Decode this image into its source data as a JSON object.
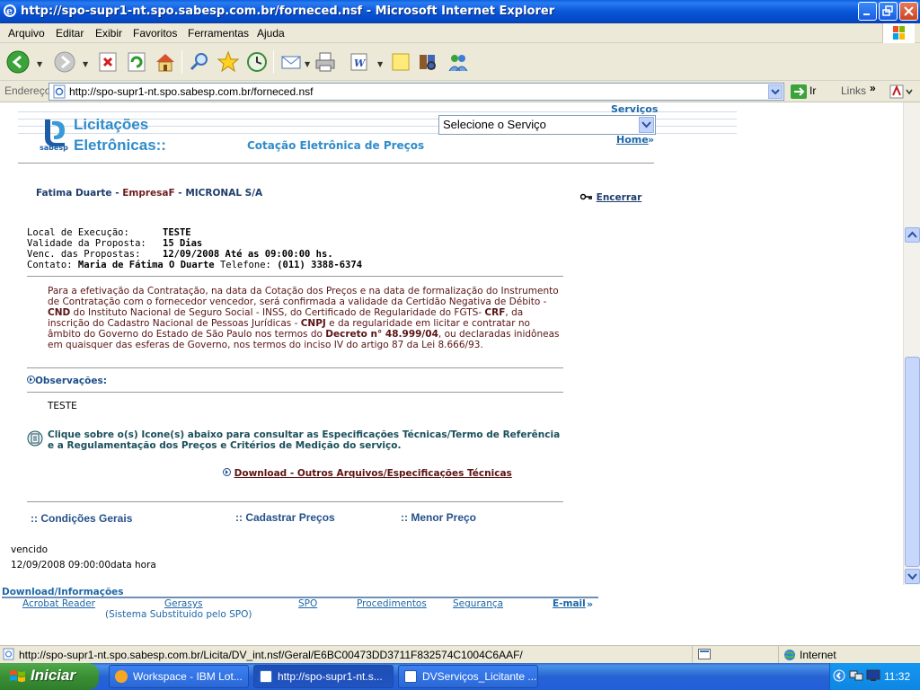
{
  "window": {
    "title": "http://spo-supr1-nt.spo.sabesp.com.br/forneced.nsf - Microsoft Internet Explorer"
  },
  "menubar": {
    "items": [
      "Arquivo",
      "Editar",
      "Exibir",
      "Favoritos",
      "Ferramentas",
      "Ajuda"
    ]
  },
  "addressbar": {
    "label": "Endereço",
    "url": "http://spo-supr1-nt.spo.sabesp.com.br/forneced.nsf",
    "go": "Ir",
    "links": "Links"
  },
  "header": {
    "logo_line1": "Licitações",
    "logo_line2": "Eletrônicas::",
    "logo_brand": "sabesp",
    "subtitle": "Cotação Eletrônica de Preços",
    "servicos_label": "Serviços",
    "service_select": "Selecione o Serviço",
    "home_link": "Home",
    "home_arrow": "»"
  },
  "user": {
    "name": "Fatima Duarte",
    "sep1": " - ",
    "company_label": "EmpresaF",
    "sep2": " - ",
    "company": "MICRONAL S/A",
    "logout": "Encerrar"
  },
  "details": {
    "local_label": "Local de Execução:",
    "local_value": "TESTE",
    "validade_label": "Validade da Proposta:",
    "validade_value": "15 Dias",
    "venc_label": "Venc. das Propostas:",
    "venc_value": "12/09/2008 Até as 09:00:00 hs.",
    "contato_label": "Contato:",
    "contato_value": "Maria de Fátima O Duarte",
    "telefone_label": "Telefone:",
    "telefone_value": "(011) 3388-6374"
  },
  "notice": {
    "p1": "Para a efetivação da Contratação, na data da Cotação dos Preços e na data de formalização do Instrumento de Contratação com o fornecedor vencedor, será confirmada a validade da Certidão Negativa de Débito - ",
    "cnd": "CND",
    "p2": " do Instituto Nacional de Seguro Social - INSS, do Certificado de Regularidade do FGTS- ",
    "crf": "CRF",
    "p3": ", da inscrição do Cadastro Nacional de Pessoas Jurídicas - ",
    "cnpj": "CNPJ",
    "p4": " e da regularidade em licitar e contratar no âmbito do Governo do Estado de São Paulo nos termos do ",
    "decreto": "Decreto n° 48.999/04",
    "p5": ", ou declaradas inidôneas em quaisquer das esferas de Governo, nos termos do inciso IV do artigo 87 da Lei 8.666/93."
  },
  "observacoes": {
    "label": "Observações:",
    "value": "TESTE"
  },
  "specs": {
    "text": "Clique sobre o(s) Icone(s) abaixo para consultar as Especificações Técnicas/Termo de Referência e a Regulamentação dos Preços e Critérios de Medição do serviço.",
    "download_link": "Download - Outros Arquivos/Especificações Técnicas"
  },
  "tabs": {
    "condicoes": ":: Condições Gerais",
    "cadastrar": ":: Cadastrar Preços",
    "menor": ":: Menor Preço"
  },
  "status_text": {
    "line1": "vencido",
    "line2": "12/09/2008 09:00:00data hora"
  },
  "footer": {
    "title": "Download/Informações",
    "links": [
      "Acrobat Reader",
      "Gerasys",
      "SPO",
      "Procedimentos",
      "Segurança",
      "E-mail"
    ],
    "email_arrow": "»",
    "note": "(Sistema Substituido pelo SPO)"
  },
  "statusbar": {
    "url": "http://spo-supr1-nt.spo.sabesp.com.br/Licita/DV_int.nsf/Geral/E6BC00473DD3711F832574C1004C6AAF/",
    "zone": "Internet"
  },
  "taskbar": {
    "start": "Iniciar",
    "tasks": [
      "Workspace - IBM Lot...",
      "http://spo-supr1-nt.s...",
      "DVServiços_Licitante ..."
    ],
    "clock": "11:32"
  },
  "colors": {
    "link_blue": "#1d67a8",
    "notice_red": "#5a1313",
    "xp_blue": "#0856d8"
  }
}
